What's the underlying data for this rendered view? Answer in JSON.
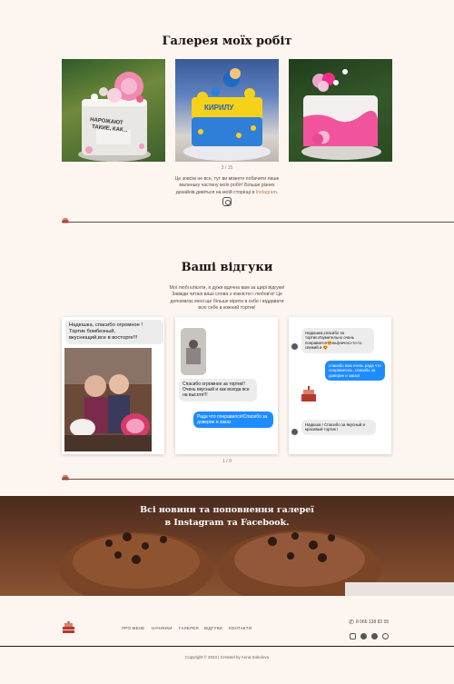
{
  "gallery": {
    "title": "Галерея моїх робіт",
    "pager": "3 / 15",
    "blurb_line1": "Це зовсім не все, тут ви можете побачити лише",
    "blurb_line2": "маленьку частину моїх робіт! Більше різних",
    "blurb_line3_pre": "дизайнів дивіться на моїй сторінці в ",
    "blurb_link": "Instagram",
    "blurb_line3_post": ".",
    "photos": [
      {
        "cake_text_1": "НАРОЖАЮТ",
        "cake_text_2": "ТАКИЕ, КАК..."
      },
      {
        "cake_text_1": "КИРИЛУ"
      },
      {}
    ]
  },
  "reviews": {
    "title": "Ваші відгуки",
    "intro_line1": "Мої любі клієнти, я дуже вдячна вам за щирі відгуки!",
    "intro_line2": "Завжди читаю ваші слова з ніжністю і любов'ю! Це",
    "intro_line3": "допомагає мені ще більше вірити в себе і віддавати",
    "intro_line4": "всю себе в кожний тортик!",
    "pager": "1 / 9",
    "card1": {
      "text_line1": "Надюшка, спасибо огромное !",
      "text_line2": "Тортик бомбезный,",
      "text_line3": "вкуснющий,все в восторге!!!"
    },
    "card2": {
      "msg1_line1": "Спасибо огромное за тортик!!",
      "msg1_line2": "Очень вкусный и как всегда все",
      "msg1_line3": "на высоте!!!",
      "msg2_line1": "Рада что понравился!Спасибо за",
      "msg2_line2": "доверие и заказ"
    },
    "card3": {
      "msg1_line1": "Надюшка,спасибо за",
      "msg1_line2": "тортик.Изумительно очень",
      "msg1_line3": "понравился😍мы(ничего-то-то",
      "msg1_line4": "свежий и 😍",
      "msg2_line1": "спасибо вам очень рада что",
      "msg2_line2": "понравилось, спасибо за",
      "msg2_line3": "доверие и заказ!",
      "msg3_line1": "Надюша ! Спасибо за вкусный и",
      "msg3_line2": "красивый тортик !"
    }
  },
  "banner": {
    "line1": "Всі новини та поповнення галереї",
    "line2": "в Instagram та Facebook."
  },
  "footer": {
    "nav": [
      "ПРО МЕНЕ",
      "НАЧИНКИ",
      "ГАЛЕРЕЯ",
      "ВІДГУКИ",
      "КОНТАКТИ"
    ],
    "phone": "8 066 138 82 05",
    "copyright": "Copyright © 2023 | Created by Anna Sokolova",
    "socials": [
      "instagram-icon",
      "facebook-icon",
      "telegram-icon",
      "viber-icon"
    ]
  },
  "colors": {
    "background": "#fdf5ef",
    "accent": "#c07a5a",
    "messenger_blue": "#1e8cff"
  }
}
